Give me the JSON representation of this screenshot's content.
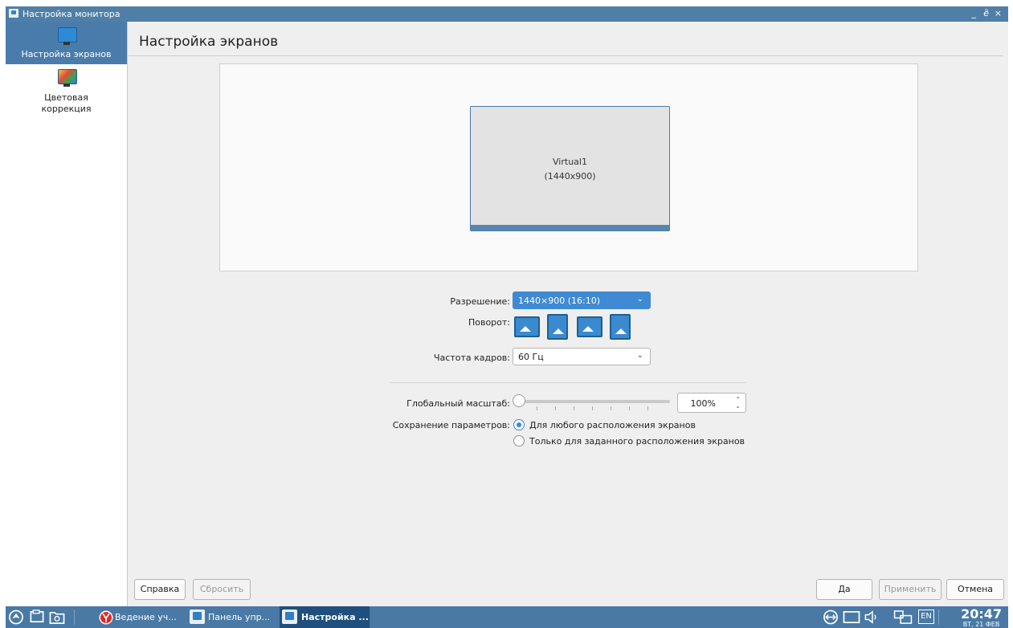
{
  "window": {
    "title": "Настройка монитора",
    "minimize": "_",
    "maximize": "ȅ",
    "close": "×"
  },
  "sidebar": {
    "items": [
      {
        "label": "Настройка экранов",
        "icon": "display-settings-icon",
        "active": true
      },
      {
        "label": "Цветовая коррекция",
        "icon": "color-correction-icon",
        "active": false
      }
    ]
  },
  "main": {
    "title": "Настройка экранов",
    "screen": {
      "name": "Virtual1",
      "size": "(1440x900)"
    },
    "resolution": {
      "label": "Разрешение:",
      "value": "1440×900 (16:10)"
    },
    "rotation": {
      "label": "Поворот:",
      "options": [
        "rotate-normal-icon",
        "rotate-left-icon",
        "rotate-inverted-icon",
        "rotate-right-icon"
      ],
      "selected": 0
    },
    "refresh": {
      "label": "Частота кадров:",
      "value": "60 Гц"
    },
    "scale": {
      "label": "Глобальный масштаб:",
      "value": "100%",
      "slider_position": 0
    },
    "save": {
      "label": "Сохранение параметров:",
      "options": [
        {
          "label": "Для любого расположения экранов",
          "checked": true
        },
        {
          "label": "Только для заданного расположения экранов",
          "checked": false
        }
      ]
    }
  },
  "buttons": {
    "help": "Справка",
    "reset": "Сбросить",
    "ok": "Да",
    "apply": "Применить",
    "cancel": "Отмена"
  },
  "taskbar": {
    "tasks": [
      {
        "label": "Ведение уч...",
        "icon": "yandex-browser-icon"
      },
      {
        "label": "Панель упр...",
        "icon": "control-panel-icon"
      },
      {
        "label": "Настройка ...",
        "icon": "monitor-settings-icon",
        "active": true
      }
    ],
    "language": "EN",
    "time": "20:47",
    "date": "ВТ, 21 ФЕВ"
  },
  "colors": {
    "titlebar": "#4f7fa6",
    "accent": "#3a8ad0",
    "taskbar": "#4979a4"
  }
}
